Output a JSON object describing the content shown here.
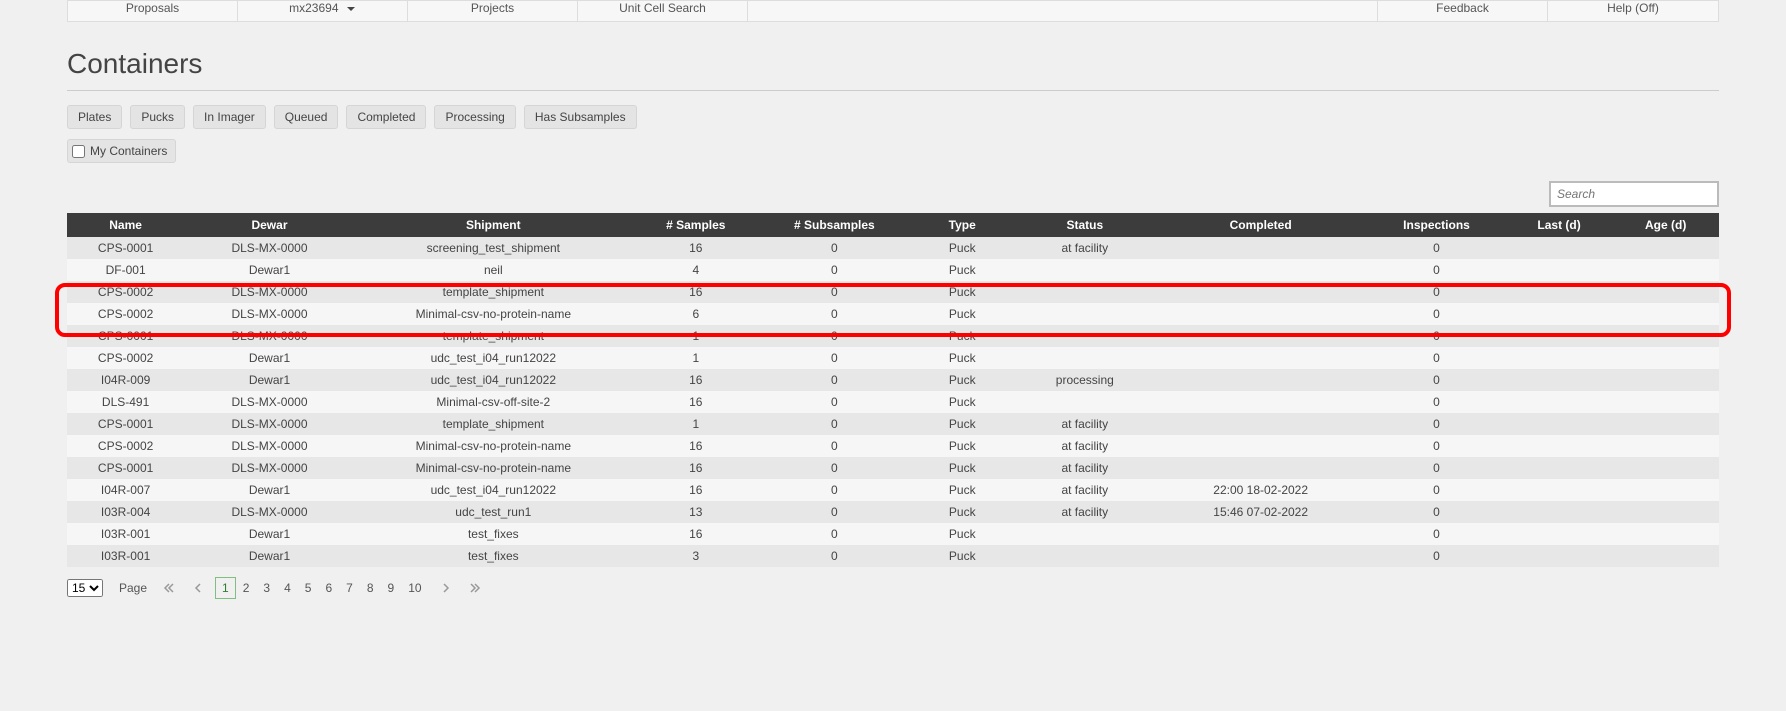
{
  "nav": {
    "proposals": "Proposals",
    "visit": "mx23694",
    "projects": "Projects",
    "unitcell": "Unit Cell Search",
    "feedback": "Feedback",
    "help": "Help (Off)"
  },
  "page": {
    "title": "Containers"
  },
  "filters": {
    "plates": "Plates",
    "pucks": "Pucks",
    "inimager": "In Imager",
    "queued": "Queued",
    "completed": "Completed",
    "processing": "Processing",
    "hassub": "Has Subsamples",
    "mycontainers": "My Containers"
  },
  "search": {
    "placeholder": "Search"
  },
  "columns": {
    "name": "Name",
    "dewar": "Dewar",
    "shipment": "Shipment",
    "samples": "# Samples",
    "subsamples": "# Subsamples",
    "type": "Type",
    "status": "Status",
    "completed": "Completed",
    "inspections": "Inspections",
    "last": "Last (d)",
    "age": "Age (d)"
  },
  "rows": [
    {
      "name": "CPS-0001",
      "dewar": "DLS-MX-0000",
      "shipment": "screening_test_shipment",
      "samples": "16",
      "subsamples": "0",
      "type": "Puck",
      "status": "at facility",
      "completed": "",
      "inspections": "0",
      "last": "",
      "age": ""
    },
    {
      "name": "DF-001",
      "dewar": "Dewar1",
      "shipment": "neil",
      "samples": "4",
      "subsamples": "0",
      "type": "Puck",
      "status": "",
      "completed": "",
      "inspections": "0",
      "last": "",
      "age": ""
    },
    {
      "name": "CPS-0002",
      "dewar": "DLS-MX-0000",
      "shipment": "template_shipment",
      "samples": "16",
      "subsamples": "0",
      "type": "Puck",
      "status": "",
      "completed": "",
      "inspections": "0",
      "last": "",
      "age": ""
    },
    {
      "name": "CPS-0002",
      "dewar": "DLS-MX-0000",
      "shipment": "Minimal-csv-no-protein-name",
      "samples": "6",
      "subsamples": "0",
      "type": "Puck",
      "status": "",
      "completed": "",
      "inspections": "0",
      "last": "",
      "age": ""
    },
    {
      "name": "CPS-0001",
      "dewar": "DLS-MX-0000",
      "shipment": "template_shipment",
      "samples": "1",
      "subsamples": "0",
      "type": "Puck",
      "status": "",
      "completed": "",
      "inspections": "0",
      "last": "",
      "age": ""
    },
    {
      "name": "CPS-0002",
      "dewar": "Dewar1",
      "shipment": "udc_test_i04_run12022",
      "samples": "1",
      "subsamples": "0",
      "type": "Puck",
      "status": "",
      "completed": "",
      "inspections": "0",
      "last": "",
      "age": ""
    },
    {
      "name": "I04R-009",
      "dewar": "Dewar1",
      "shipment": "udc_test_i04_run12022",
      "samples": "16",
      "subsamples": "0",
      "type": "Puck",
      "status": "processing",
      "completed": "",
      "inspections": "0",
      "last": "",
      "age": ""
    },
    {
      "name": "DLS-491",
      "dewar": "DLS-MX-0000",
      "shipment": "Minimal-csv-off-site-2",
      "samples": "16",
      "subsamples": "0",
      "type": "Puck",
      "status": "",
      "completed": "",
      "inspections": "0",
      "last": "",
      "age": ""
    },
    {
      "name": "CPS-0001",
      "dewar": "DLS-MX-0000",
      "shipment": "template_shipment",
      "samples": "1",
      "subsamples": "0",
      "type": "Puck",
      "status": "at facility",
      "completed": "",
      "inspections": "0",
      "last": "",
      "age": ""
    },
    {
      "name": "CPS-0002",
      "dewar": "DLS-MX-0000",
      "shipment": "Minimal-csv-no-protein-name",
      "samples": "16",
      "subsamples": "0",
      "type": "Puck",
      "status": "at facility",
      "completed": "",
      "inspections": "0",
      "last": "",
      "age": ""
    },
    {
      "name": "CPS-0001",
      "dewar": "DLS-MX-0000",
      "shipment": "Minimal-csv-no-protein-name",
      "samples": "16",
      "subsamples": "0",
      "type": "Puck",
      "status": "at facility",
      "completed": "",
      "inspections": "0",
      "last": "",
      "age": ""
    },
    {
      "name": "I04R-007",
      "dewar": "Dewar1",
      "shipment": "udc_test_i04_run12022",
      "samples": "16",
      "subsamples": "0",
      "type": "Puck",
      "status": "at facility",
      "completed": "22:00 18-02-2022",
      "inspections": "0",
      "last": "",
      "age": ""
    },
    {
      "name": "I03R-004",
      "dewar": "DLS-MX-0000",
      "shipment": "udc_test_run1",
      "samples": "13",
      "subsamples": "0",
      "type": "Puck",
      "status": "at facility",
      "completed": "15:46 07-02-2022",
      "inspections": "0",
      "last": "",
      "age": ""
    },
    {
      "name": "I03R-001",
      "dewar": "Dewar1",
      "shipment": "test_fixes",
      "samples": "16",
      "subsamples": "0",
      "type": "Puck",
      "status": "",
      "completed": "",
      "inspections": "0",
      "last": "",
      "age": ""
    },
    {
      "name": "I03R-001",
      "dewar": "Dewar1",
      "shipment": "test_fixes",
      "samples": "3",
      "subsamples": "0",
      "type": "Puck",
      "status": "",
      "completed": "",
      "inspections": "0",
      "last": "",
      "age": ""
    }
  ],
  "pager": {
    "perpage": "15",
    "label": "Page",
    "pages": [
      "1",
      "2",
      "3",
      "4",
      "5",
      "6",
      "7",
      "8",
      "9",
      "10"
    ],
    "active": "1"
  },
  "highlight_row_index": 3
}
